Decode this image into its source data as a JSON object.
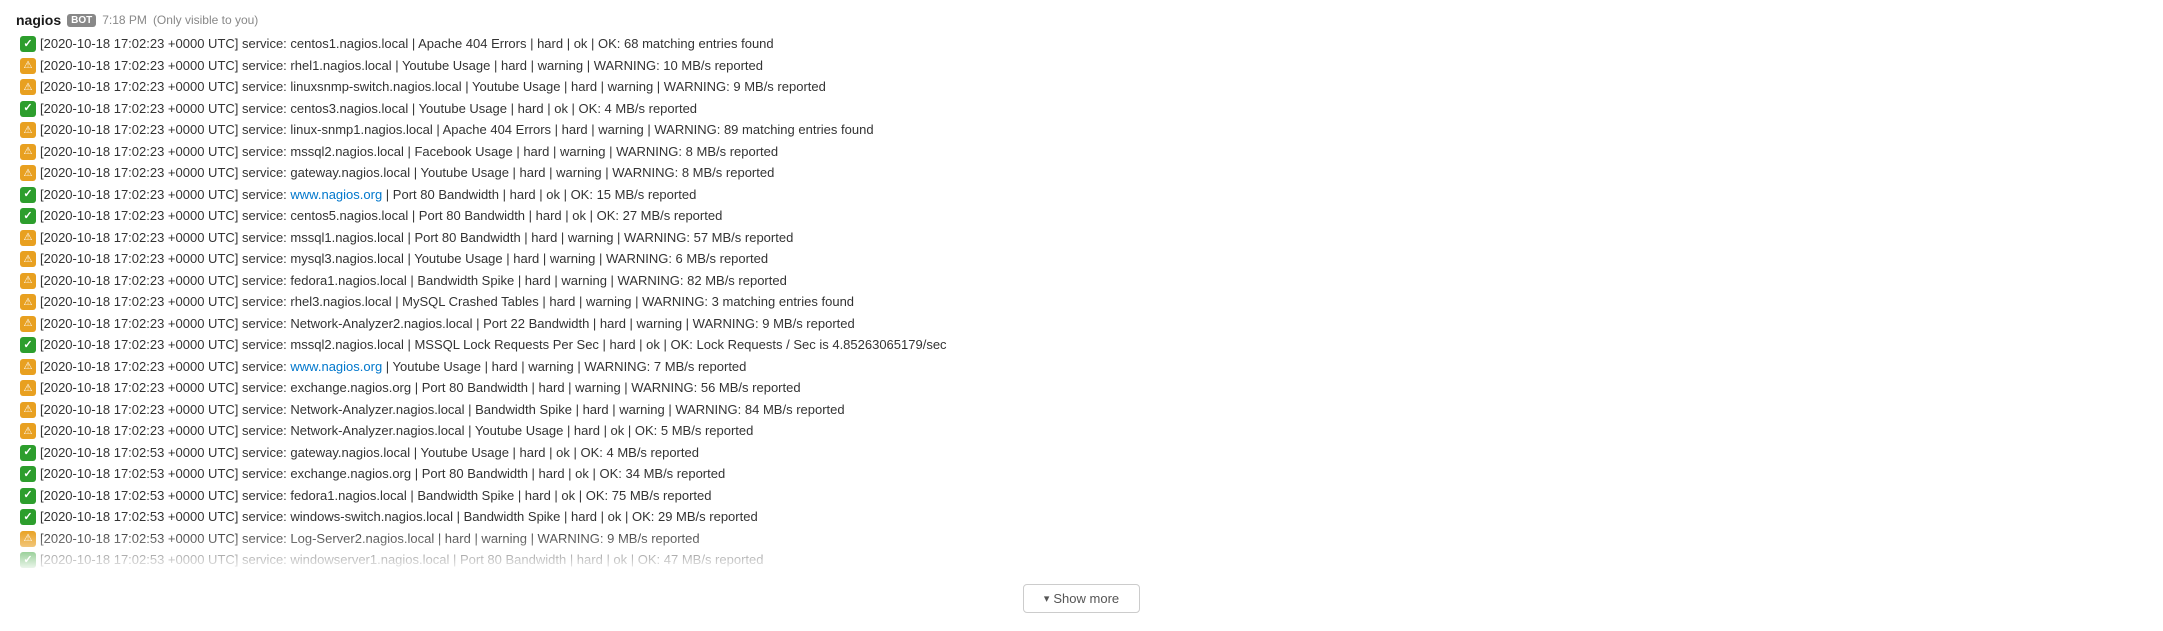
{
  "header": {
    "bot_name": "nagios",
    "bot_badge": "BOT",
    "timestamp": "7:18 PM",
    "visibility_note": "(Only visible to you)"
  },
  "show_more": {
    "label": "Show more",
    "chevron": "▾"
  },
  "log_entries": [
    {
      "status": "ok",
      "text": "[2020-10-18 17:02:23 +0000 UTC] service: centos1.nagios.local | Apache 404 Errors | hard | ok | OK: 68 matching entries found"
    },
    {
      "status": "warning",
      "text": "[2020-10-18 17:02:23 +0000 UTC] service: rhel1.nagios.local | Youtube Usage | hard | warning | WARNING: 10 MB/s reported"
    },
    {
      "status": "warning",
      "text": "[2020-10-18 17:02:23 +0000 UTC] service: linuxsnmp-switch.nagios.local | Youtube Usage | hard | warning | WARNING: 9 MB/s reported"
    },
    {
      "status": "ok",
      "text": "[2020-10-18 17:02:23 +0000 UTC] service: centos3.nagios.local | Youtube Usage | hard | ok | OK: 4 MB/s reported"
    },
    {
      "status": "warning",
      "text": "[2020-10-18 17:02:23 +0000 UTC] service: linux-snmp1.nagios.local | Apache 404 Errors | hard | warning | WARNING: 89 matching entries found"
    },
    {
      "status": "warning",
      "text": "[2020-10-18 17:02:23 +0000 UTC] service: mssql2.nagios.local | Facebook Usage | hard | warning | WARNING: 8 MB/s reported"
    },
    {
      "status": "warning",
      "text": "[2020-10-18 17:02:23 +0000 UTC] service: gateway.nagios.local | Youtube Usage | hard | warning | WARNING: 8 MB/s reported"
    },
    {
      "status": "ok",
      "text": "[2020-10-18 17:02:23 +0000 UTC] service: www.nagios.org | Port 80 Bandwidth | hard | ok | OK: 15 MB/s reported",
      "link": "www.nagios.org"
    },
    {
      "status": "ok",
      "text": "[2020-10-18 17:02:23 +0000 UTC] service: centos5.nagios.local | Port 80 Bandwidth | hard | ok | OK: 27 MB/s reported"
    },
    {
      "status": "warning",
      "text": "[2020-10-18 17:02:23 +0000 UTC] service: mssql1.nagios.local | Port 80 Bandwidth | hard | warning | WARNING: 57 MB/s reported"
    },
    {
      "status": "warning",
      "text": "[2020-10-18 17:02:23 +0000 UTC] service: mysql3.nagios.local | Youtube Usage | hard | warning | WARNING: 6 MB/s reported"
    },
    {
      "status": "warning",
      "text": "[2020-10-18 17:02:23 +0000 UTC] service: fedora1.nagios.local | Bandwidth Spike | hard | warning | WARNING: 82 MB/s reported"
    },
    {
      "status": "warning",
      "text": "[2020-10-18 17:02:23 +0000 UTC] service: rhel3.nagios.local | MySQL Crashed Tables | hard | warning | WARNING: 3 matching entries found"
    },
    {
      "status": "warning",
      "text": "[2020-10-18 17:02:23 +0000 UTC] service: Network-Analyzer2.nagios.local | Port 22 Bandwidth | hard | warning | WARNING: 9 MB/s reported"
    },
    {
      "status": "ok",
      "text": "[2020-10-18 17:02:23 +0000 UTC] service: mssql2.nagios.local | MSSQL Lock Requests Per Sec | hard | ok | OK: Lock Requests / Sec is 4.85263065179/sec"
    },
    {
      "status": "warning",
      "text": "[2020-10-18 17:02:23 +0000 UTC] service: www.nagios.org | Youtube Usage | hard | warning | WARNING: 7 MB/s reported",
      "link": "www.nagios.org"
    },
    {
      "status": "warning",
      "text": "[2020-10-18 17:02:23 +0000 UTC] service: exchange.nagios.org | Port 80 Bandwidth | hard | warning | WARNING: 56 MB/s reported"
    },
    {
      "status": "warning",
      "text": "[2020-10-18 17:02:23 +0000 UTC] service: Network-Analyzer.nagios.local | Bandwidth Spike | hard | warning | WARNING: 84 MB/s reported"
    },
    {
      "status": "warning",
      "text": "[2020-10-18 17:02:23 +0000 UTC] service: Network-Analyzer.nagios.local | Youtube Usage | hard | ok | OK: 5 MB/s reported"
    },
    {
      "status": "ok",
      "text": "[2020-10-18 17:02:53 +0000 UTC] service: gateway.nagios.local | Youtube Usage | hard | ok | OK: 4 MB/s reported"
    },
    {
      "status": "ok",
      "text": "[2020-10-18 17:02:53 +0000 UTC] service: exchange.nagios.org | Port 80 Bandwidth | hard | ok | OK: 34 MB/s reported"
    },
    {
      "status": "ok",
      "text": "[2020-10-18 17:02:53 +0000 UTC] service: fedora1.nagios.local | Bandwidth Spike | hard | ok | OK: 75 MB/s reported"
    },
    {
      "status": "ok",
      "text": "[2020-10-18 17:02:53 +0000 UTC] service: windows-switch.nagios.local | Bandwidth Spike | hard | ok | OK: 29 MB/s reported"
    },
    {
      "status": "warning",
      "text": "[2020-10-18 17:02:53 +0000 UTC] service: Log-Server2.nagios.local | hard | warning | WARNING: 9 MB/s reported"
    },
    {
      "status": "ok",
      "text": "[2020-10-18 17:02:53 +0000 UTC] service: windowserver1.nagios.local | Port 80 Bandwidth | hard | ok | OK: 47 MB/s reported"
    }
  ]
}
